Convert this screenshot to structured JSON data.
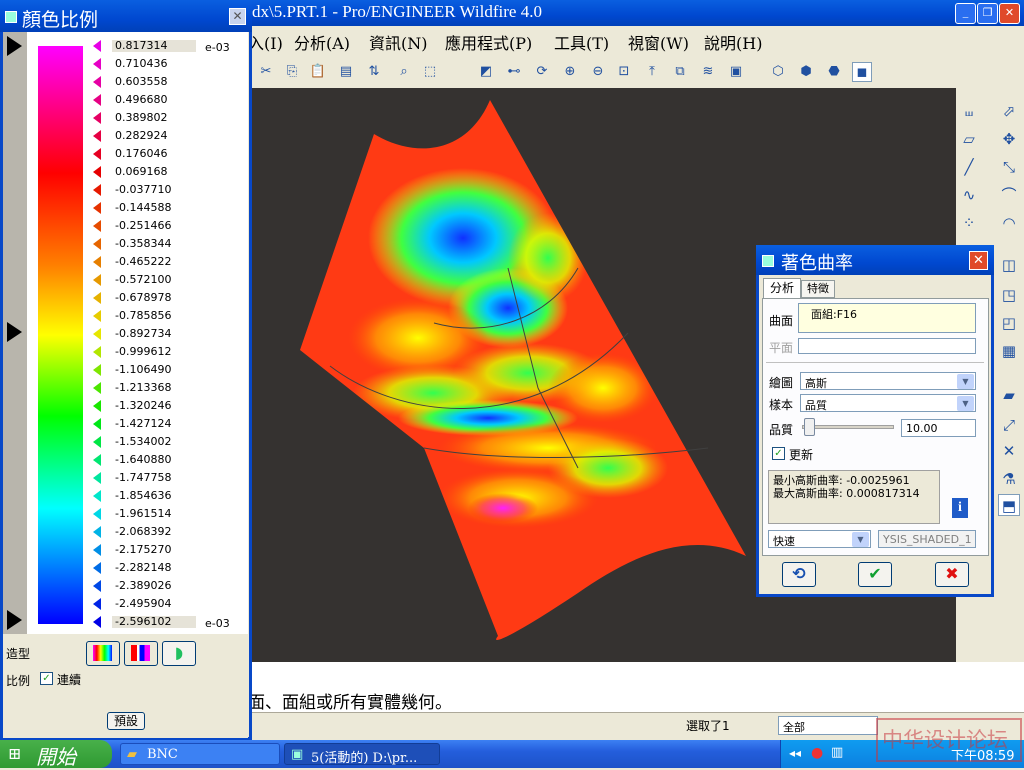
{
  "main_window": {
    "title": "dx\\5.PRT.1 - Pro/ENGINEER Wildfire 4.0"
  },
  "menu": [
    "入(I)",
    "分析(A)",
    "資訊(N)",
    "應用程式(P)",
    "工具(T)",
    "視窗(W)",
    "說明(H)"
  ],
  "color_scale": {
    "title": "顏色比例",
    "exponent_top": "e-03",
    "exponent_bottom": "e-03",
    "values": [
      "0.817314",
      "0.710436",
      "0.603558",
      "0.496680",
      "0.389802",
      "0.282924",
      "0.176046",
      "0.069168",
      "-0.037710",
      "-0.144588",
      "-0.251466",
      "-0.358344",
      "-0.465222",
      "-0.572100",
      "-0.678978",
      "-0.785856",
      "-0.892734",
      "-0.999612",
      "-1.106490",
      "-1.213368",
      "-1.320246",
      "-1.427124",
      "-1.534002",
      "-1.640880",
      "-1.747758",
      "-1.854636",
      "-1.961514",
      "-2.068392",
      "-2.175270",
      "-2.282148",
      "-2.389026",
      "-2.495904",
      "-2.596102"
    ],
    "style_label": "造型",
    "scale_label": "比例",
    "continuous_label": "連續",
    "continuous_checked": true,
    "default_button": "預設"
  },
  "dialog": {
    "title": "著色曲率",
    "tab_analysis": "分析",
    "tab_features": "特徵",
    "surface_label": "曲面",
    "surface_value": "面組:F16",
    "plane_label": "平面",
    "plot_label": "繪圖",
    "plot_value": "高斯",
    "sample_label": "樣本",
    "sample_value": "品質",
    "quality_label": "品質",
    "quality_value": "10.00",
    "update_label": "更新",
    "update_checked": true,
    "min_text": "最小高斯曲率: -0.0025961",
    "max_text": "最大高斯曲率: 0.000817314",
    "mode_value": "快速",
    "name_value": "YSIS_SHADED_1"
  },
  "message": "面、面組或所有實體幾何。",
  "status": {
    "selected": "選取了1",
    "filter": "全部"
  },
  "taskbar": {
    "start": "開始",
    "task1": "BNC",
    "task2": "5(活動的) D:\\pr...",
    "clock": "下午08:59"
  },
  "watermark": "中华设计论坛",
  "colors": {
    "titlebar": "#0048d0",
    "viewport_bg": "#353230",
    "surface_base": "#ff3a14"
  }
}
